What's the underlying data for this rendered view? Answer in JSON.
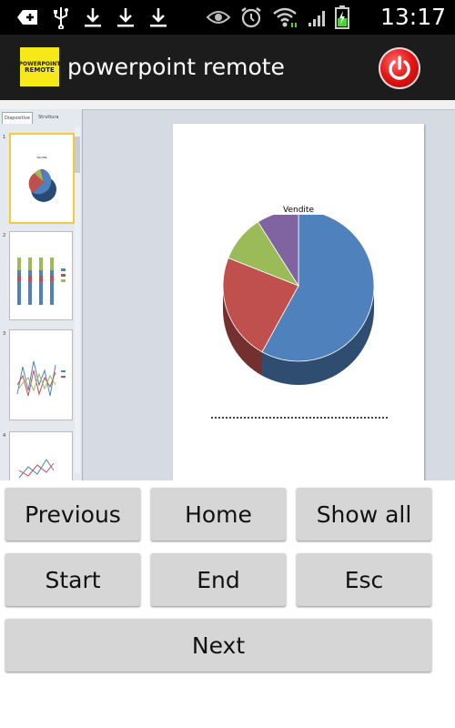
{
  "status_bar": {
    "time": "13:17",
    "icons": [
      "android-debug-icon",
      "usb-icon",
      "download-icon",
      "download-icon",
      "download-icon",
      "eye-icon",
      "alarm-icon",
      "wifi-icon",
      "signal-icon",
      "battery-charging-icon"
    ]
  },
  "app_bar": {
    "logo_line1": "POWERPOINT",
    "logo_line2": "REMOTE",
    "title": "powerpoint remote",
    "power_icon": "power-icon"
  },
  "preview": {
    "tabs": [
      "Diapositive",
      "Struttura"
    ],
    "slide_title": "Vendite",
    "thumbnail_numbers": [
      "1",
      "2",
      "3",
      "4"
    ],
    "pie": {
      "slices": [
        {
          "value": 58,
          "color": "#4f81bd"
        },
        {
          "value": 23,
          "color": "#c0504d"
        },
        {
          "value": 10,
          "color": "#9bbb59"
        },
        {
          "value": 9,
          "color": "#8064a2"
        }
      ]
    }
  },
  "buttons": {
    "previous": "Previous",
    "home": "Home",
    "show_all": "Show all",
    "start": "Start",
    "end": "End",
    "esc": "Esc",
    "next": "Next"
  }
}
